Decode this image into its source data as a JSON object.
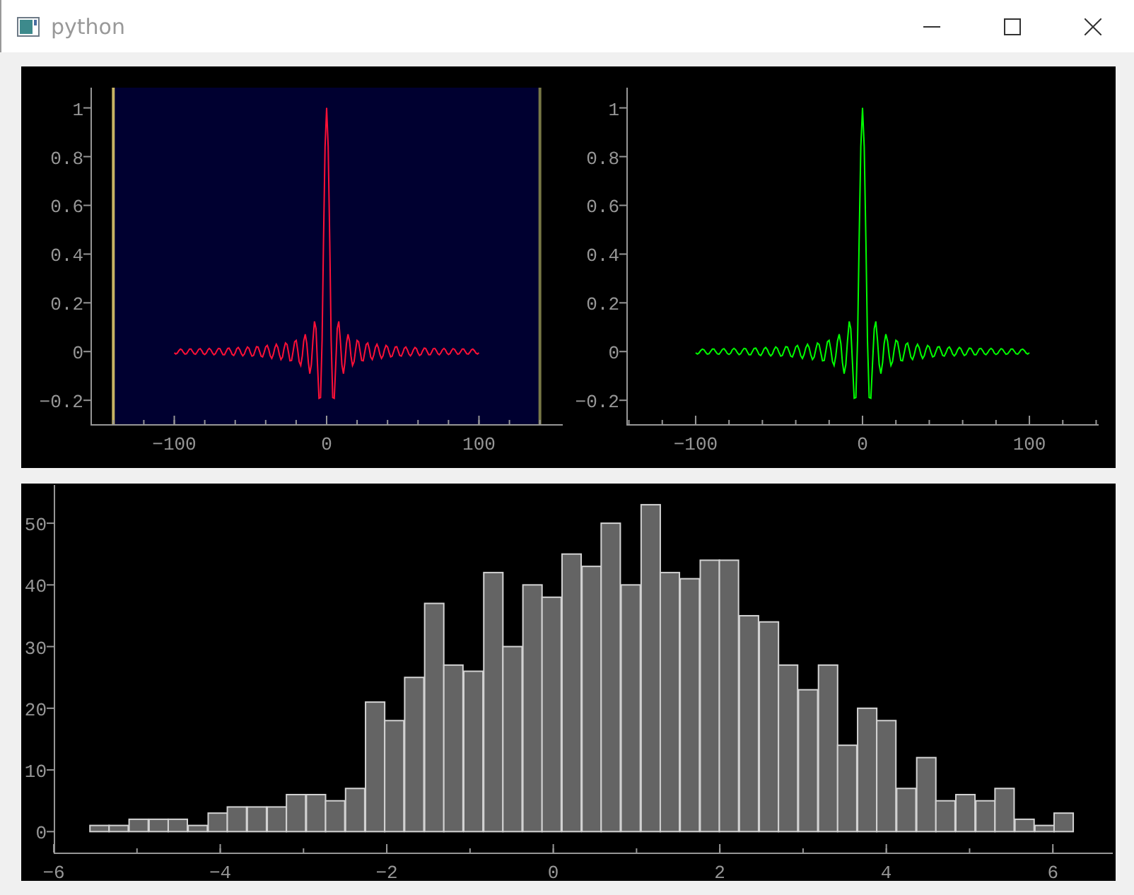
{
  "window": {
    "title": "python"
  },
  "top_plots": [
    {
      "chart_data": {
        "type": "line",
        "xlim": [
          -155,
          155
        ],
        "ylim": [
          -0.298,
          1.083
        ],
        "xticks": [
          {
            "value": -100,
            "label": "−100"
          },
          {
            "value": 0,
            "label": "0"
          },
          {
            "value": 100,
            "label": "100"
          }
        ],
        "yticks": [
          {
            "value": -0.2,
            "label": "−0.2"
          },
          0,
          0.2,
          0.4,
          0.6,
          0.8,
          1
        ],
        "x": [
          -100,
          -99,
          -98,
          -97,
          -96,
          -95,
          -94,
          -93,
          -92,
          -91,
          -90,
          -89,
          -88,
          -87,
          -86,
          -85,
          -84,
          -83,
          -82,
          -81,
          -80,
          -79,
          -78,
          -77,
          -76,
          -75,
          -74,
          -73,
          -72,
          -71,
          -70,
          -69,
          -68,
          -67,
          -66,
          -65,
          -64,
          -63,
          -62,
          -61,
          -60,
          -59,
          -58,
          -57,
          -56,
          -55,
          -54,
          -53,
          -52,
          -51,
          -50,
          -49,
          -48,
          -47,
          -46,
          -45,
          -44,
          -43,
          -42,
          -41,
          -40,
          -39,
          -38,
          -37,
          -36,
          -35,
          -34,
          -33,
          -32,
          -31,
          -30,
          -29,
          -28,
          -27,
          -26,
          -25,
          -24,
          -23,
          -22,
          -21,
          -20,
          -19,
          -18,
          -17,
          -16,
          -15,
          -14,
          -13,
          -12,
          -11,
          -10,
          -9,
          -8,
          -7,
          -6,
          -5,
          -4,
          -3,
          -2,
          -1,
          0,
          1,
          2,
          3,
          4,
          5,
          6,
          7,
          8,
          9,
          10,
          11,
          12,
          13,
          14,
          15,
          16,
          17,
          18,
          19,
          20,
          21,
          22,
          23,
          24,
          25,
          26,
          27,
          28,
          29,
          30,
          31,
          32,
          33,
          34,
          35,
          36,
          37,
          38,
          39,
          40,
          41,
          42,
          43,
          44,
          45,
          46,
          47,
          48,
          49,
          50,
          51,
          52,
          53,
          54,
          55,
          56,
          57,
          58,
          59,
          60,
          61,
          62,
          63,
          64,
          65,
          66,
          67,
          68,
          69,
          70,
          71,
          72,
          73,
          74,
          75,
          76,
          77,
          78,
          79,
          80,
          81,
          82,
          83,
          84,
          85,
          86,
          87,
          88,
          89,
          90,
          91,
          92,
          93,
          94,
          95,
          96,
          97,
          98,
          99,
          100
        ],
        "series": [
          {
            "color": "#ff1037",
            "values": [
              -0.005,
              -0.01,
              -0.006,
              0.004,
              0.01,
              0.007,
              -0.003,
              -0.01,
              -0.009,
              0.001,
              0.01,
              0.01,
              0,
              -0.009,
              -0.011,
              -0.002,
              0.009,
              0.012,
              0.004,
              -0.008,
              -0.012,
              -0.006,
              0.007,
              0.013,
              0.007,
              -0.005,
              -0.013,
              -0.009,
              0.004,
              0.013,
              0.011,
              -0.002,
              -0.013,
              -0.013,
              0,
              0.013,
              0.014,
              0.003,
              -0.012,
              -0.016,
              -0.005,
              0.011,
              0.017,
              0.008,
              -0.009,
              -0.018,
              -0.01,
              0.007,
              0.019,
              0.013,
              -0.005,
              -0.019,
              -0.016,
              0.003,
              0.02,
              0.019,
              0,
              -0.019,
              -0.022,
              -0.004,
              0.019,
              0.025,
              0.008,
              -0.017,
              -0.028,
              -0.012,
              0.016,
              0.03,
              0.017,
              -0.013,
              -0.033,
              -0.023,
              0.01,
              0.035,
              0.029,
              -0.005,
              -0.038,
              -0.037,
              0,
              0.04,
              0.046,
              0.008,
              -0.042,
              -0.057,
              -0.018,
              0.043,
              0.071,
              0.032,
              -0.045,
              -0.091,
              -0.054,
              0.046,
              0.124,
              0.094,
              -0.047,
              -0.192,
              -0.189,
              0.047,
              0.455,
              0.841,
              1,
              0.841,
              0.455,
              0.047,
              -0.189,
              -0.192,
              -0.047,
              0.094,
              0.124,
              0.046,
              -0.054,
              -0.091,
              -0.045,
              0.032,
              0.071,
              0.043,
              -0.018,
              -0.057,
              -0.042,
              0.008,
              0.046,
              0.04,
              0,
              -0.037,
              -0.038,
              -0.005,
              0.029,
              0.035,
              0.01,
              -0.023,
              -0.033,
              -0.013,
              0.017,
              0.03,
              0.016,
              -0.012,
              -0.028,
              -0.017,
              0.008,
              0.025,
              0.019,
              -0.004,
              -0.022,
              -0.019,
              0,
              0.019,
              0.02,
              0.003,
              -0.016,
              -0.019,
              -0.005,
              0.013,
              0.019,
              0.007,
              -0.01,
              -0.018,
              -0.009,
              0.008,
              0.017,
              0.011,
              -0.005,
              -0.016,
              -0.012,
              0.003,
              0.014,
              0.013,
              0,
              -0.013,
              -0.013,
              -0.002,
              0.011,
              0.013,
              0.004,
              -0.009,
              -0.013,
              -0.005,
              0.007,
              0.013,
              0.007,
              -0.006,
              -0.012,
              -0.008,
              0.004,
              0.012,
              0.009,
              -0.002,
              -0.011,
              -0.009,
              0,
              0.01,
              0.01,
              0.001,
              -0.009,
              -0.01,
              -0.003,
              0.007,
              0.01,
              0.004,
              -0.006,
              -0.01,
              -0.005
            ]
          }
        ],
        "bands": [
          {
            "axis": "x",
            "from": -140,
            "to": 140,
            "color": "#000030"
          }
        ],
        "ref_lines": [
          {
            "axis": "x",
            "value": -140,
            "color": "#c8b464"
          },
          {
            "axis": "x",
            "value": 140,
            "color": "#787846"
          }
        ]
      }
    },
    {
      "chart_data": {
        "type": "line",
        "xlim": [
          -141.5,
          141.5
        ],
        "ylim": [
          -0.298,
          1.083
        ],
        "xticks": [
          {
            "value": -100,
            "label": "−100"
          },
          {
            "value": 0,
            "label": "0"
          },
          {
            "value": 100,
            "label": "100"
          }
        ],
        "yticks": [
          {
            "value": -0.2,
            "label": "−0.2"
          },
          0,
          0.2,
          0.4,
          0.6,
          0.8,
          1
        ],
        "x": [
          -100,
          -99,
          -98,
          -97,
          -96,
          -95,
          -94,
          -93,
          -92,
          -91,
          -90,
          -89,
          -88,
          -87,
          -86,
          -85,
          -84,
          -83,
          -82,
          -81,
          -80,
          -79,
          -78,
          -77,
          -76,
          -75,
          -74,
          -73,
          -72,
          -71,
          -70,
          -69,
          -68,
          -67,
          -66,
          -65,
          -64,
          -63,
          -62,
          -61,
          -60,
          -59,
          -58,
          -57,
          -56,
          -55,
          -54,
          -53,
          -52,
          -51,
          -50,
          -49,
          -48,
          -47,
          -46,
          -45,
          -44,
          -43,
          -42,
          -41,
          -40,
          -39,
          -38,
          -37,
          -36,
          -35,
          -34,
          -33,
          -32,
          -31,
          -30,
          -29,
          -28,
          -27,
          -26,
          -25,
          -24,
          -23,
          -22,
          -21,
          -20,
          -19,
          -18,
          -17,
          -16,
          -15,
          -14,
          -13,
          -12,
          -11,
          -10,
          -9,
          -8,
          -7,
          -6,
          -5,
          -4,
          -3,
          -2,
          -1,
          0,
          1,
          2,
          3,
          4,
          5,
          6,
          7,
          8,
          9,
          10,
          11,
          12,
          13,
          14,
          15,
          16,
          17,
          18,
          19,
          20,
          21,
          22,
          23,
          24,
          25,
          26,
          27,
          28,
          29,
          30,
          31,
          32,
          33,
          34,
          35,
          36,
          37,
          38,
          39,
          40,
          41,
          42,
          43,
          44,
          45,
          46,
          47,
          48,
          49,
          50,
          51,
          52,
          53,
          54,
          55,
          56,
          57,
          58,
          59,
          60,
          61,
          62,
          63,
          64,
          65,
          66,
          67,
          68,
          69,
          70,
          71,
          72,
          73,
          74,
          75,
          76,
          77,
          78,
          79,
          80,
          81,
          82,
          83,
          84,
          85,
          86,
          87,
          88,
          89,
          90,
          91,
          92,
          93,
          94,
          95,
          96,
          97,
          98,
          99,
          100
        ],
        "series": [
          {
            "color": "#00ff00",
            "values": [
              -0.005,
              -0.01,
              -0.006,
              0.004,
              0.01,
              0.007,
              -0.003,
              -0.01,
              -0.009,
              0.001,
              0.01,
              0.01,
              0,
              -0.009,
              -0.011,
              -0.002,
              0.009,
              0.012,
              0.004,
              -0.008,
              -0.012,
              -0.006,
              0.007,
              0.013,
              0.007,
              -0.005,
              -0.013,
              -0.009,
              0.004,
              0.013,
              0.011,
              -0.002,
              -0.013,
              -0.013,
              0,
              0.013,
              0.014,
              0.003,
              -0.012,
              -0.016,
              -0.005,
              0.011,
              0.017,
              0.008,
              -0.009,
              -0.018,
              -0.01,
              0.007,
              0.019,
              0.013,
              -0.005,
              -0.019,
              -0.016,
              0.003,
              0.02,
              0.019,
              0,
              -0.019,
              -0.022,
              -0.004,
              0.019,
              0.025,
              0.008,
              -0.017,
              -0.028,
              -0.012,
              0.016,
              0.03,
              0.017,
              -0.013,
              -0.033,
              -0.023,
              0.01,
              0.035,
              0.029,
              -0.005,
              -0.038,
              -0.037,
              0,
              0.04,
              0.046,
              0.008,
              -0.042,
              -0.057,
              -0.018,
              0.043,
              0.071,
              0.032,
              -0.045,
              -0.091,
              -0.054,
              0.046,
              0.124,
              0.094,
              -0.047,
              -0.192,
              -0.189,
              0.047,
              0.455,
              0.841,
              1,
              0.841,
              0.455,
              0.047,
              -0.189,
              -0.192,
              -0.047,
              0.094,
              0.124,
              0.046,
              -0.054,
              -0.091,
              -0.045,
              0.032,
              0.071,
              0.043,
              -0.018,
              -0.057,
              -0.042,
              0.008,
              0.046,
              0.04,
              0,
              -0.037,
              -0.038,
              -0.005,
              0.029,
              0.035,
              0.01,
              -0.023,
              -0.033,
              -0.013,
              0.017,
              0.03,
              0.016,
              -0.012,
              -0.028,
              -0.017,
              0.008,
              0.025,
              0.019,
              -0.004,
              -0.022,
              -0.019,
              0,
              0.019,
              0.02,
              0.003,
              -0.016,
              -0.019,
              -0.005,
              0.013,
              0.019,
              0.007,
              -0.01,
              -0.018,
              -0.009,
              0.008,
              0.017,
              0.011,
              -0.005,
              -0.016,
              -0.012,
              0.003,
              0.014,
              0.013,
              0,
              -0.013,
              -0.013,
              -0.002,
              0.011,
              0.013,
              0.004,
              -0.009,
              -0.013,
              -0.005,
              0.007,
              0.013,
              0.007,
              -0.006,
              -0.012,
              -0.008,
              0.004,
              0.012,
              0.009,
              -0.002,
              -0.011,
              -0.009,
              0,
              0.01,
              0.01,
              0.001,
              -0.009,
              -0.01,
              -0.003,
              0.007,
              0.01,
              0.004,
              -0.006,
              -0.01,
              -0.005
            ]
          }
        ]
      }
    }
  ],
  "histogram": {
    "chart_data": {
      "type": "bar",
      "xlim": [
        -6,
        6.72
      ],
      "ylim": [
        -3.4,
        56.2
      ],
      "xticks": [
        {
          "value": -6,
          "label": "−6"
        },
        {
          "value": -4,
          "label": "−4"
        },
        {
          "value": -2,
          "label": "−2"
        },
        0,
        2,
        4,
        6
      ],
      "yticks": [
        0,
        10,
        20,
        30,
        40,
        50
      ],
      "x": [
        -5.45,
        -5.22,
        -4.98,
        -4.74,
        -4.51,
        -4.27,
        -4.03,
        -3.8,
        -3.56,
        -3.32,
        -3.09,
        -2.85,
        -2.62,
        -2.38,
        -2.14,
        -1.91,
        -1.67,
        -1.43,
        -1.2,
        -0.96,
        -0.72,
        -0.49,
        -0.25,
        -0.02,
        0.22,
        0.46,
        0.69,
        0.93,
        1.17,
        1.4,
        1.64,
        1.88,
        2.11,
        2.35,
        2.59,
        2.82,
        3.06,
        3.3,
        3.53,
        3.77,
        4.0,
        4.24,
        4.48,
        4.71,
        4.95,
        5.19,
        5.42,
        5.66,
        5.9,
        6.13
      ],
      "values": [
        1,
        1,
        2,
        2,
        2,
        1,
        3,
        4,
        4,
        4,
        6,
        6,
        5,
        7,
        21,
        18,
        25,
        37,
        27,
        26,
        42,
        30,
        40,
        38,
        45,
        43,
        50,
        40,
        53,
        42,
        41,
        44,
        44,
        35,
        34,
        27,
        23,
        27,
        14,
        20,
        18,
        7,
        12,
        5,
        6,
        5,
        7,
        2,
        1,
        3
      ]
    }
  }
}
